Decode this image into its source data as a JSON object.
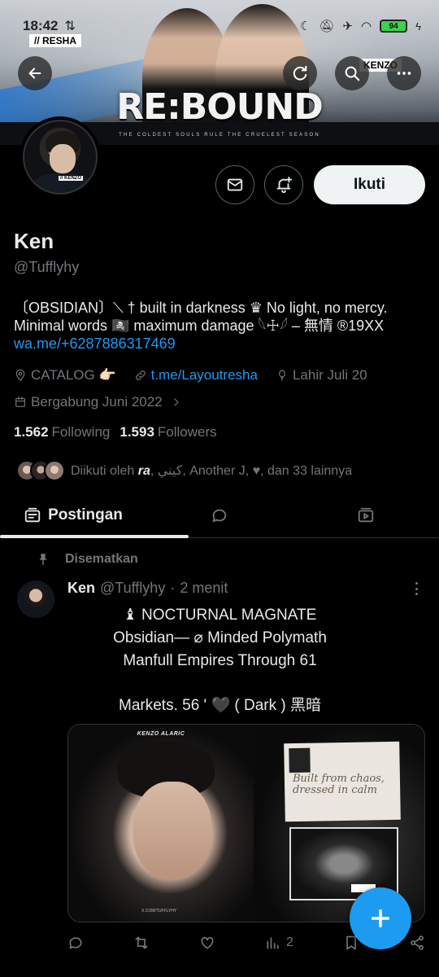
{
  "status_bar": {
    "time": "18:42",
    "battery": "94",
    "icons": [
      "sync-icon",
      "moon-icon",
      "mute-icon",
      "airplane-icon",
      "wifi-icon",
      "battery-icon",
      "charging-icon"
    ]
  },
  "banner": {
    "title": "RE:BOUND",
    "tagline": "THE COLDEST SOULS RULE THE CRUELEST SEASON",
    "tag_left": "// RESHA",
    "tag_right": "KENZO"
  },
  "avatar_label": "// KENZO",
  "header_buttons": [
    "back-icon",
    "sync-icon",
    "search-icon",
    "more-icon"
  ],
  "profile": {
    "name": "Ken",
    "handle": "@Tufflyhy",
    "bio_line1": "〔OBSIDIAN〕⟍ † built in darkness ♛ No light, no mercy.",
    "bio_line2": "Minimal words 🏴‍☠️ maximum damage 𓆩☩𓆪 – 無情 ®19XX",
    "bio_link": "wa.me/+6287886317469",
    "follow_label": "Ikuti",
    "meta": {
      "location": "CATALOG 👉🏻",
      "website": "t.me/Layoutresha",
      "birthday": "Lahir Juli 20",
      "joined": "Bergabung Juni 2022"
    },
    "following_count": "1.562",
    "following_label": "Following",
    "followers_count": "1.593",
    "followers_label": "Followers",
    "followed_by_prefix": "Diikuti oleh",
    "followed_by_first": "ra",
    "followed_by_rest": ", كيني, Another J, ♥, dan 33 lainnya"
  },
  "tabs": [
    {
      "label": "Postingan",
      "icon": "posts-icon",
      "active": true
    },
    {
      "label": "",
      "icon": "replies-icon",
      "active": false
    },
    {
      "label": "",
      "icon": "media-icon",
      "active": false
    }
  ],
  "post": {
    "pinned_label": "Disematkan",
    "author_name": "Ken",
    "author_handle": "@Tufflyhy",
    "separator": "·",
    "time": "2 menit",
    "line1": "♝ NOCTURNAL MAGNATE",
    "line2": "Obsidian— ⌀ Minded Polymath",
    "line3": "Manfull Empires Through 61",
    "line4": "Markets. 56 ' 🖤 ( Dark )   黑暗",
    "media_caption": "KENZO ALARIC",
    "media_url": "X.COM/TUFFLYHY",
    "media_script": "Built from chaos, dressed in calm",
    "views": "2"
  },
  "colors": {
    "accent": "#1d9bf0",
    "background": "#000000",
    "text": "#e7e9ea",
    "muted": "#71767b"
  }
}
